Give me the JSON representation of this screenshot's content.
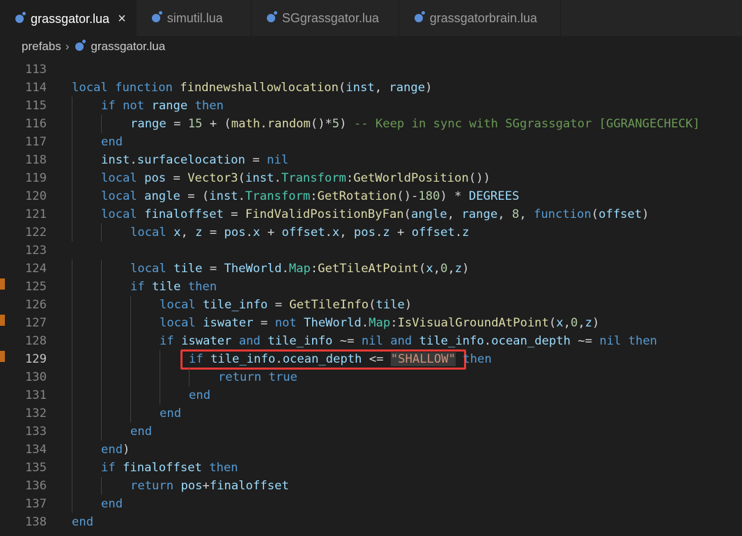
{
  "tabs": [
    {
      "label": "grassgator.lua",
      "active": true,
      "icon": "lua-file-icon"
    },
    {
      "label": "simutil.lua",
      "active": false,
      "icon": "lua-file-icon"
    },
    {
      "label": "SGgrassgator.lua",
      "active": false,
      "icon": "lua-file-icon"
    },
    {
      "label": "grassgatorbrain.lua",
      "active": false,
      "icon": "lua-file-icon"
    }
  ],
  "close_symbol": "×",
  "breadcrumb": {
    "folder": "prefabs",
    "separator": "›",
    "file": "grassgator.lua"
  },
  "current_line": 129,
  "colors": {
    "keyword": "#569cd6",
    "function": "#dcdcaa",
    "comment": "#6a9955",
    "string": "#ce9178",
    "highlight_box": "#e53935"
  },
  "lines": [
    {
      "n": 113,
      "indent": 0,
      "tokens": []
    },
    {
      "n": 114,
      "indent": 0,
      "tokens": [
        [
          "kw",
          "local"
        ],
        [
          "pl",
          " "
        ],
        [
          "kw",
          "function"
        ],
        [
          "pl",
          " "
        ],
        [
          "fn",
          "findnewshallowlocation"
        ],
        [
          "pl",
          "("
        ],
        [
          "var",
          "inst"
        ],
        [
          "pl",
          ", "
        ],
        [
          "var",
          "range"
        ],
        [
          "pl",
          ")"
        ]
      ]
    },
    {
      "n": 115,
      "indent": 1,
      "tokens": [
        [
          "kw",
          "if"
        ],
        [
          "pl",
          " "
        ],
        [
          "kw",
          "not"
        ],
        [
          "pl",
          " "
        ],
        [
          "var",
          "range"
        ],
        [
          "pl",
          " "
        ],
        [
          "kw",
          "then"
        ]
      ]
    },
    {
      "n": 116,
      "indent": 2,
      "tokens": [
        [
          "var",
          "range"
        ],
        [
          "pl",
          " = "
        ],
        [
          "num",
          "15"
        ],
        [
          "pl",
          " + ("
        ],
        [
          "fn",
          "math.random"
        ],
        [
          "pl",
          "()*"
        ],
        [
          "num",
          "5"
        ],
        [
          "pl",
          ") "
        ],
        [
          "cm",
          "-- Keep in sync with SGgrassgator [GGRANGECHECK]"
        ]
      ]
    },
    {
      "n": 117,
      "indent": 1,
      "tokens": [
        [
          "kw",
          "end"
        ]
      ]
    },
    {
      "n": 118,
      "indent": 1,
      "tokens": [
        [
          "var",
          "inst"
        ],
        [
          "pl",
          "."
        ],
        [
          "var",
          "surfacelocation"
        ],
        [
          "pl",
          " = "
        ],
        [
          "kw",
          "nil"
        ]
      ]
    },
    {
      "n": 119,
      "indent": 1,
      "tokens": [
        [
          "kw",
          "local"
        ],
        [
          "pl",
          " "
        ],
        [
          "var",
          "pos"
        ],
        [
          "pl",
          " = "
        ],
        [
          "fn",
          "Vector3"
        ],
        [
          "pl",
          "("
        ],
        [
          "var",
          "inst"
        ],
        [
          "pl",
          "."
        ],
        [
          "prop",
          "Transform"
        ],
        [
          "pl",
          ":"
        ],
        [
          "fn",
          "GetWorldPosition"
        ],
        [
          "pl",
          "())"
        ]
      ]
    },
    {
      "n": 120,
      "indent": 1,
      "tokens": [
        [
          "kw",
          "local"
        ],
        [
          "pl",
          " "
        ],
        [
          "var",
          "angle"
        ],
        [
          "pl",
          " = ("
        ],
        [
          "var",
          "inst"
        ],
        [
          "pl",
          "."
        ],
        [
          "prop",
          "Transform"
        ],
        [
          "pl",
          ":"
        ],
        [
          "fn",
          "GetRotation"
        ],
        [
          "pl",
          "()-"
        ],
        [
          "num",
          "180"
        ],
        [
          "pl",
          ") * "
        ],
        [
          "var",
          "DEGREES"
        ]
      ]
    },
    {
      "n": 121,
      "indent": 1,
      "tokens": [
        [
          "kw",
          "local"
        ],
        [
          "pl",
          " "
        ],
        [
          "var",
          "finaloffset"
        ],
        [
          "pl",
          " = "
        ],
        [
          "fn",
          "FindValidPositionByFan"
        ],
        [
          "pl",
          "("
        ],
        [
          "var",
          "angle"
        ],
        [
          "pl",
          ", "
        ],
        [
          "var",
          "range"
        ],
        [
          "pl",
          ", "
        ],
        [
          "num",
          "8"
        ],
        [
          "pl",
          ", "
        ],
        [
          "kw",
          "function"
        ],
        [
          "pl",
          "("
        ],
        [
          "var",
          "offset"
        ],
        [
          "pl",
          ")"
        ]
      ]
    },
    {
      "n": 122,
      "indent": 2,
      "tokens": [
        [
          "kw",
          "local"
        ],
        [
          "pl",
          " "
        ],
        [
          "var",
          "x"
        ],
        [
          "pl",
          ", "
        ],
        [
          "var",
          "z"
        ],
        [
          "pl",
          " = "
        ],
        [
          "var",
          "pos"
        ],
        [
          "pl",
          "."
        ],
        [
          "var",
          "x"
        ],
        [
          "pl",
          " + "
        ],
        [
          "var",
          "offset"
        ],
        [
          "pl",
          "."
        ],
        [
          "var",
          "x"
        ],
        [
          "pl",
          ", "
        ],
        [
          "var",
          "pos"
        ],
        [
          "pl",
          "."
        ],
        [
          "var",
          "z"
        ],
        [
          "pl",
          " + "
        ],
        [
          "var",
          "offset"
        ],
        [
          "pl",
          "."
        ],
        [
          "var",
          "z"
        ]
      ]
    },
    {
      "n": 123,
      "indent": 0,
      "tokens": []
    },
    {
      "n": 124,
      "indent": 2,
      "tokens": [
        [
          "kw",
          "local"
        ],
        [
          "pl",
          " "
        ],
        [
          "var",
          "tile"
        ],
        [
          "pl",
          " = "
        ],
        [
          "var",
          "TheWorld"
        ],
        [
          "pl",
          "."
        ],
        [
          "prop",
          "Map"
        ],
        [
          "pl",
          ":"
        ],
        [
          "fn",
          "GetTileAtPoint"
        ],
        [
          "pl",
          "("
        ],
        [
          "var",
          "x"
        ],
        [
          "pl",
          ","
        ],
        [
          "num",
          "0"
        ],
        [
          "pl",
          ","
        ],
        [
          "var",
          "z"
        ],
        [
          "pl",
          ")"
        ]
      ]
    },
    {
      "n": 125,
      "indent": 2,
      "tokens": [
        [
          "kw",
          "if"
        ],
        [
          "pl",
          " "
        ],
        [
          "var",
          "tile"
        ],
        [
          "pl",
          " "
        ],
        [
          "kw",
          "then"
        ]
      ]
    },
    {
      "n": 126,
      "indent": 3,
      "tokens": [
        [
          "kw",
          "local"
        ],
        [
          "pl",
          " "
        ],
        [
          "var",
          "tile_info"
        ],
        [
          "pl",
          " = "
        ],
        [
          "fn",
          "GetTileInfo"
        ],
        [
          "pl",
          "("
        ],
        [
          "var",
          "tile"
        ],
        [
          "pl",
          ")"
        ]
      ]
    },
    {
      "n": 127,
      "indent": 3,
      "tokens": [
        [
          "kw",
          "local"
        ],
        [
          "pl",
          " "
        ],
        [
          "var",
          "iswater"
        ],
        [
          "pl",
          " = "
        ],
        [
          "kw",
          "not"
        ],
        [
          "pl",
          " "
        ],
        [
          "var",
          "TheWorld"
        ],
        [
          "pl",
          "."
        ],
        [
          "prop",
          "Map"
        ],
        [
          "pl",
          ":"
        ],
        [
          "fn",
          "IsVisualGroundAtPoint"
        ],
        [
          "pl",
          "("
        ],
        [
          "var",
          "x"
        ],
        [
          "pl",
          ","
        ],
        [
          "num",
          "0"
        ],
        [
          "pl",
          ","
        ],
        [
          "var",
          "z"
        ],
        [
          "pl",
          ")"
        ]
      ]
    },
    {
      "n": 128,
      "indent": 3,
      "tokens": [
        [
          "kw",
          "if"
        ],
        [
          "pl",
          " "
        ],
        [
          "var",
          "iswater"
        ],
        [
          "pl",
          " "
        ],
        [
          "kw",
          "and"
        ],
        [
          "pl",
          " "
        ],
        [
          "var",
          "tile_info"
        ],
        [
          "pl",
          " ~= "
        ],
        [
          "kw",
          "nil"
        ],
        [
          "pl",
          " "
        ],
        [
          "kw",
          "and"
        ],
        [
          "pl",
          " "
        ],
        [
          "var",
          "tile_info"
        ],
        [
          "pl",
          "."
        ],
        [
          "var",
          "ocean_depth"
        ],
        [
          "pl",
          " ~= "
        ],
        [
          "kw",
          "nil"
        ],
        [
          "pl",
          " "
        ],
        [
          "kw",
          "then"
        ]
      ]
    },
    {
      "n": 129,
      "indent": 4,
      "tokens": [
        [
          "kw",
          "if"
        ],
        [
          "pl",
          " "
        ],
        [
          "var",
          "tile_info"
        ],
        [
          "pl",
          "."
        ],
        [
          "var",
          "ocean_depth"
        ],
        [
          "pl",
          " <= "
        ],
        [
          "str",
          "\"SHALLOW\""
        ],
        [
          "pl",
          " "
        ],
        [
          "kw",
          "then"
        ]
      ]
    },
    {
      "n": 130,
      "indent": 5,
      "tokens": [
        [
          "kw",
          "return"
        ],
        [
          "pl",
          " "
        ],
        [
          "kw",
          "true"
        ]
      ]
    },
    {
      "n": 131,
      "indent": 4,
      "tokens": [
        [
          "kw",
          "end"
        ]
      ]
    },
    {
      "n": 132,
      "indent": 3,
      "tokens": [
        [
          "kw",
          "end"
        ]
      ]
    },
    {
      "n": 133,
      "indent": 2,
      "tokens": [
        [
          "kw",
          "end"
        ]
      ]
    },
    {
      "n": 134,
      "indent": 1,
      "tokens": [
        [
          "kw",
          "end"
        ],
        [
          "pl",
          ")"
        ]
      ]
    },
    {
      "n": 135,
      "indent": 1,
      "tokens": [
        [
          "kw",
          "if"
        ],
        [
          "pl",
          " "
        ],
        [
          "var",
          "finaloffset"
        ],
        [
          "pl",
          " "
        ],
        [
          "kw",
          "then"
        ]
      ]
    },
    {
      "n": 136,
      "indent": 2,
      "tokens": [
        [
          "kw",
          "return"
        ],
        [
          "pl",
          " "
        ],
        [
          "var",
          "pos"
        ],
        [
          "pl",
          "+"
        ],
        [
          "var",
          "finaloffset"
        ]
      ]
    },
    {
      "n": 137,
      "indent": 1,
      "tokens": [
        [
          "kw",
          "end"
        ]
      ]
    },
    {
      "n": 138,
      "indent": 0,
      "tokens": [
        [
          "kw",
          "end"
        ]
      ]
    }
  ]
}
